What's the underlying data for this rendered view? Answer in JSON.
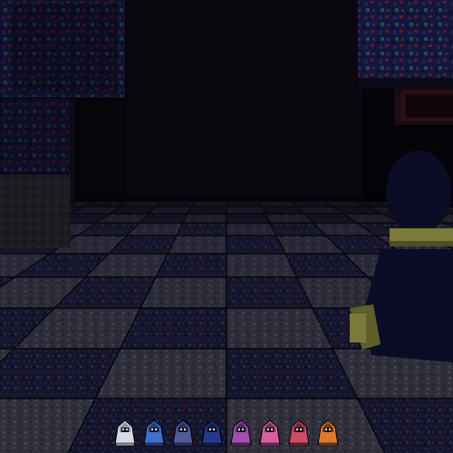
{
  "scene": {
    "palette": {
      "sky": "#040307",
      "far_wall": "#0a0914",
      "floor_light": "#383845",
      "floor_dark": "#151530",
      "block_dark": "#14142c",
      "block_light": "#2e2e3a",
      "accent_red": "#6a1f2a",
      "accent_teal": "#1e4a55",
      "player_body": "#0d0c26",
      "player_trim": "#7a7a3a"
    }
  },
  "hotbar": {
    "slots": [
      {
        "name": "white-hooded-figure-icon",
        "color": "#d8d8e6",
        "shade": "#8d8da0"
      },
      {
        "name": "blue-hooded-figure-icon",
        "color": "#3c72cc",
        "shade": "#1f3f78"
      },
      {
        "name": "slate-hooded-figure-icon",
        "color": "#4f5b9a",
        "shade": "#2a3060"
      },
      {
        "name": "navy-hooded-figure-icon",
        "color": "#243a8e",
        "shade": "#121e52"
      },
      {
        "name": "violet-hooded-figure-icon",
        "color": "#a14fb0",
        "shade": "#5a2466"
      },
      {
        "name": "pink-hooded-figure-icon",
        "color": "#d85f9e",
        "shade": "#7a2c58"
      },
      {
        "name": "crimson-hooded-figure-icon",
        "color": "#cc4b62",
        "shade": "#6e2230"
      },
      {
        "name": "orange-hooded-figure-icon",
        "color": "#df7a2c",
        "shade": "#7c3a10"
      }
    ]
  }
}
